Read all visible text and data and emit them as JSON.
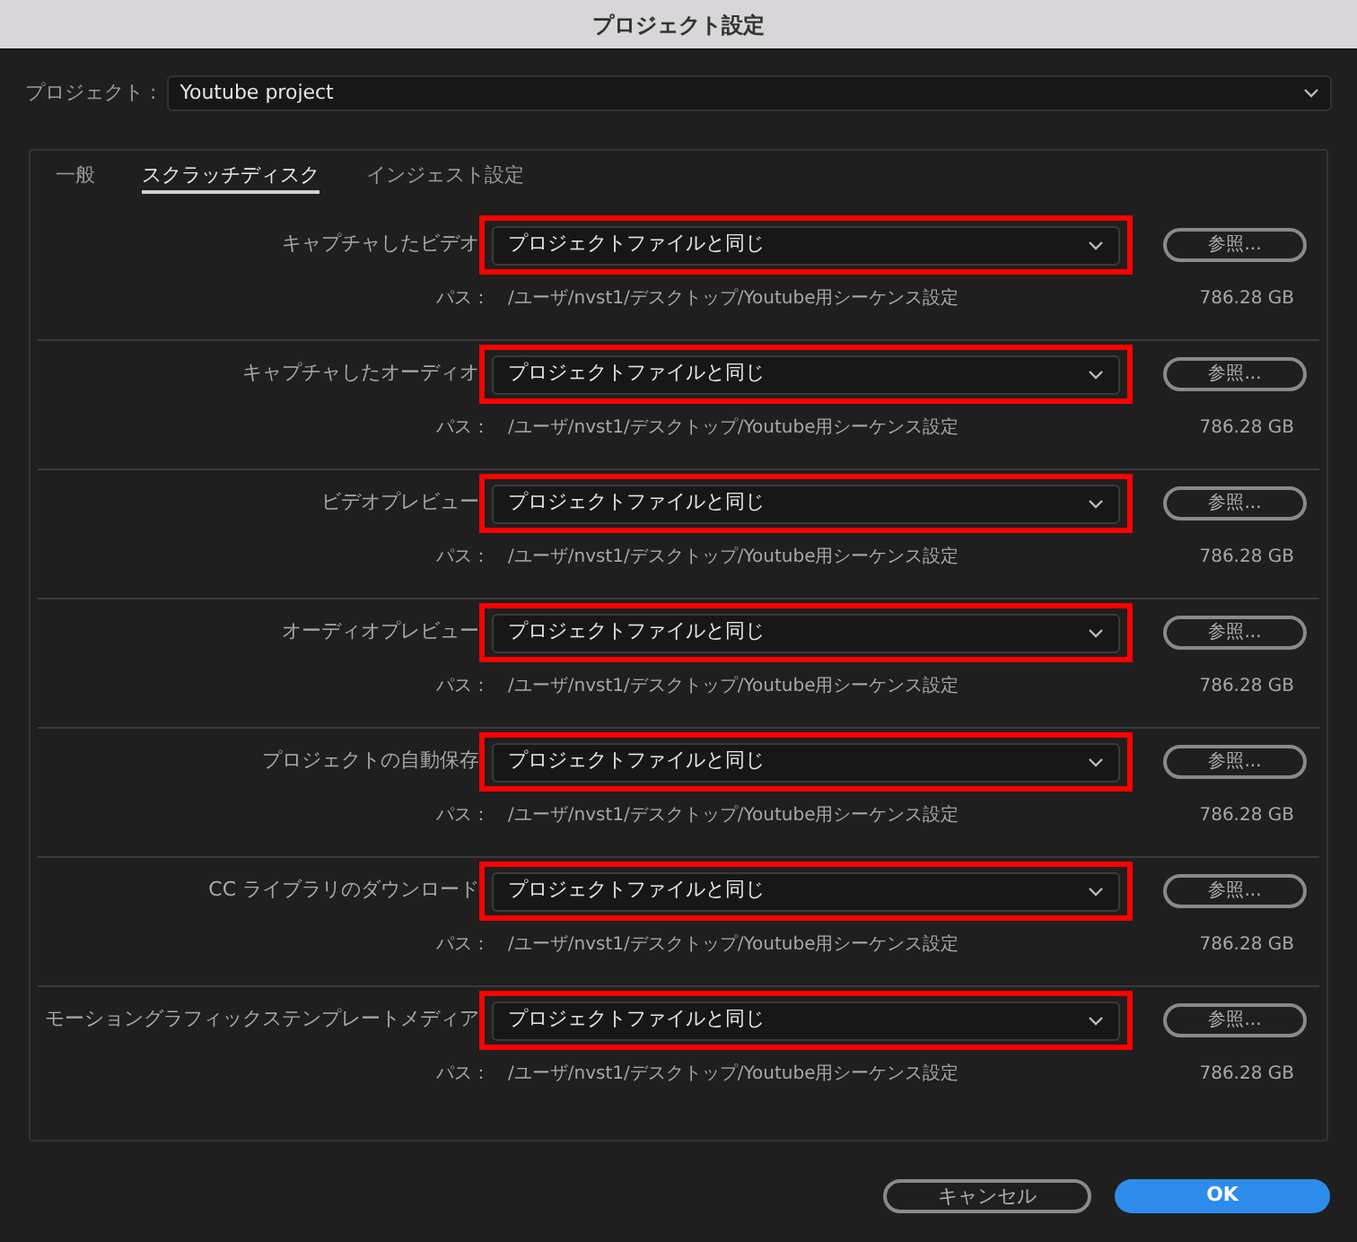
{
  "window": {
    "title": "プロジェクト設定"
  },
  "project": {
    "label": "プロジェクト :",
    "value": "Youtube project"
  },
  "tabs": [
    {
      "label": "一般",
      "selected": false
    },
    {
      "label": "スクラッチディスク",
      "selected": true
    },
    {
      "label": "インジェスト設定",
      "selected": false
    }
  ],
  "rows": [
    {
      "label": "キャプチャしたビデオ",
      "value": "プロジェクトファイルと同じ",
      "highlighted": true,
      "browse": "参照...",
      "path_label": "パス：",
      "path": "/ユーザ/nvst1/デスクトップ/Youtube用シーケンス設定",
      "size": "786.28 GB"
    },
    {
      "label": "キャプチャしたオーディオ",
      "value": "プロジェクトファイルと同じ",
      "highlighted": true,
      "browse": "参照...",
      "path_label": "パス：",
      "path": "/ユーザ/nvst1/デスクトップ/Youtube用シーケンス設定",
      "size": "786.28 GB"
    },
    {
      "label": "ビデオプレビュー",
      "value": "プロジェクトファイルと同じ",
      "highlighted": true,
      "browse": "参照...",
      "path_label": "パス：",
      "path": "/ユーザ/nvst1/デスクトップ/Youtube用シーケンス設定",
      "size": "786.28 GB"
    },
    {
      "label": "オーディオプレビュー",
      "value": "プロジェクトファイルと同じ",
      "highlighted": true,
      "browse": "参照...",
      "path_label": "パス：",
      "path": "/ユーザ/nvst1/デスクトップ/Youtube用シーケンス設定",
      "size": "786.28 GB"
    },
    {
      "label": "プロジェクトの自動保存",
      "value": "プロジェクトファイルと同じ",
      "highlighted": true,
      "browse": "参照...",
      "path_label": "パス：",
      "path": "/ユーザ/nvst1/デスクトップ/Youtube用シーケンス設定",
      "size": "786.28 GB"
    },
    {
      "label": "CC ライブラリのダウンロード",
      "value": "プロジェクトファイルと同じ",
      "highlighted": true,
      "browse": "参照...",
      "path_label": "パス：",
      "path": "/ユーザ/nvst1/デスクトップ/Youtube用シーケンス設定",
      "size": "786.28 GB"
    },
    {
      "label": "モーショングラフィックステンプレートメディア",
      "value": "プロジェクトファイルと同じ",
      "highlighted": true,
      "browse": "参照...",
      "path_label": "パス：",
      "path": "/ユーザ/nvst1/デスクトップ/Youtube用シーケンス設定",
      "size": "786.28 GB"
    }
  ],
  "buttons": [
    {
      "label": "キャンセル",
      "kind": "secondary"
    },
    {
      "label": "OK",
      "kind": "primary"
    }
  ]
}
